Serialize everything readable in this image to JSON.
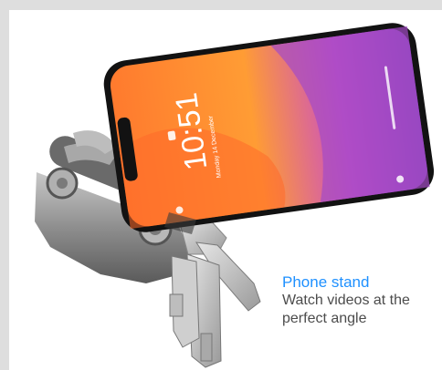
{
  "product_photo": {
    "subject": "keyring-organizer-phone-stand",
    "lockscreen": {
      "time": "10:51",
      "date": "Monday 14 December"
    }
  },
  "caption": {
    "title": "Phone stand",
    "line1": "Watch videos at the",
    "line2": "perfect angle"
  },
  "colors": {
    "page_background": "#dedede",
    "card_background": "#ffffff",
    "caption_title": "#1e90ff",
    "caption_text": "#4c4c4c"
  }
}
